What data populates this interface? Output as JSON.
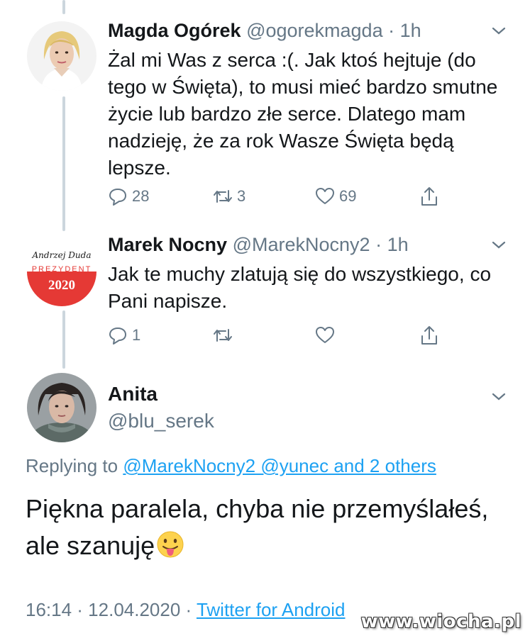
{
  "tweets": [
    {
      "name": "Magda Ogórek",
      "handle": "@ogorekmagda",
      "time": "1h",
      "text": "Żal mi Was z serca :(. Jak ktoś hejtuje (do tego w Święta), to musi mieć bardzo smutne życie lub bardzo złe serce. Dlatego mam nadzieję, że za rok Wasze Święta będą lepsze.",
      "replies": "28",
      "retweets": "3",
      "likes": "69",
      "avatar_icon": "woman-portrait"
    },
    {
      "name": "Marek Nocny",
      "handle": "@MarekNocny2",
      "time": "1h",
      "text": "Jak te muchy zlatują się do wszystkiego, co Pani napisze.",
      "replies": "1",
      "retweets": "",
      "likes": "",
      "avatar": {
        "script_top": "Andrzej Duda",
        "label": "PREZYDENT",
        "year": "2020"
      }
    }
  ],
  "main_tweet": {
    "name": "Anita",
    "handle": "@blu_serek",
    "replying_prefix": "Replying to",
    "replying_to": "@MarekNocny2 @yunec and 2 others",
    "text": "Piękna paralela, chyba nie przemyślałeś, ale szanuję",
    "emoji": "tongue-out-face",
    "timestamp": "16:14 · 12.04.2020 ·",
    "source": "Twitter for Android"
  },
  "watermark": "www.wiocha.pl",
  "colors": {
    "link": "#1da1f2",
    "muted": "#657786",
    "thread_line": "#ccd6dd",
    "badge_red": "#e53935"
  }
}
